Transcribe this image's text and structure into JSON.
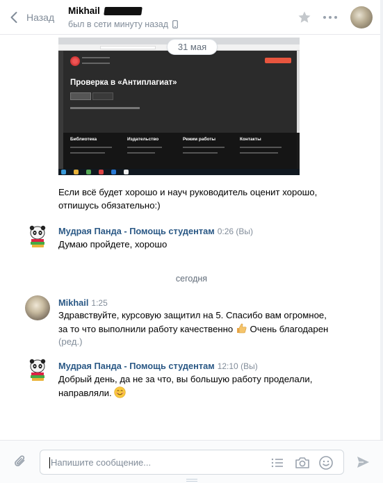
{
  "header": {
    "back_label": "Назад",
    "peer_name": "Mikhail",
    "peer_status": "был в сети минуту назад",
    "icons": [
      "chevron-left-icon",
      "phone-icon",
      "star-icon",
      "more-dots-icon"
    ]
  },
  "date_pill": "31 мая",
  "screenshot": {
    "heading": "Проверка в «Антиплагиат»",
    "footer_cols": [
      "Библиотека",
      "Издательство",
      "Режим работы",
      "Контакты"
    ]
  },
  "messages": [
    {
      "text": "Если всё будет хорошо и науч руководитель оценит хорошо, отпишусь обязательно:)"
    },
    {
      "sender": "Мудрая Панда - Помощь студентам",
      "time": "0:26",
      "tag": "(Вы)",
      "text": "Думаю пройдете, хорошо"
    },
    {
      "sender": "Mikhail",
      "time": "1:25",
      "text_before": "Здравствуйте, курсовую защитил на 5. Спасибо вам огромное, за то что выполнили работу качественно",
      "text_after": "Очень благодарен",
      "edited": "(ред.)",
      "emoji": "thumbs-up"
    },
    {
      "sender": "Мудрая Панда - Помощь студентам",
      "time": "12:10",
      "tag": "(Вы)",
      "text": "Добрый день, да не за что, вы большую работу проделали, направляли.",
      "emoji": "blush"
    }
  ],
  "day_separator": "сегодня",
  "composer": {
    "placeholder": "Напишите сообщение...",
    "icons": [
      "paperclip-icon",
      "list-icon",
      "camera-icon",
      "smile-icon",
      "send-icon"
    ]
  },
  "colors": {
    "link": "#2a5885",
    "muted": "#818c99",
    "border": "#e7e8ec"
  }
}
